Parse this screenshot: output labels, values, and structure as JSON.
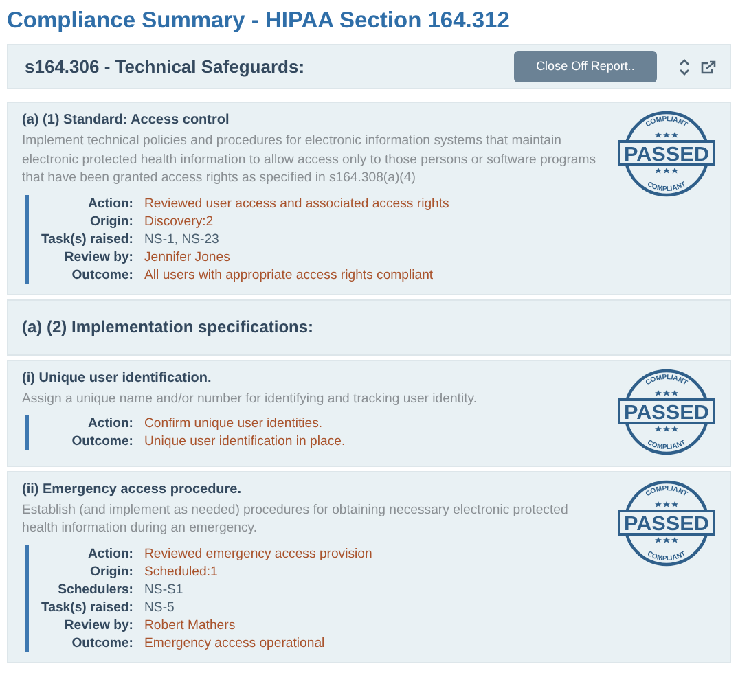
{
  "page_title": "Compliance Summary - HIPAA Section 164.312",
  "header": {
    "title": "s164.306 - Technical Safeguards:",
    "button": "Close Off Report.."
  },
  "sections": [
    {
      "kind": "item",
      "title": "(a) (1) Standard: Access control",
      "description": "Implement technical policies and procedures for electronic information systems that maintain electronic protected health information to allow access only to those persons or software programs that have been granted access rights as specified in s164.308(a)(4)",
      "stamp": {
        "top": "COMPLIANT",
        "label": "PASSED",
        "bottom": "COMPLIANT"
      },
      "details": [
        {
          "label": "Action:",
          "value": "Reviewed user access and associated access rights",
          "kind": "note"
        },
        {
          "label": "Origin:",
          "value": "Discovery:2",
          "kind": "note"
        },
        {
          "label": "Task(s) raised:",
          "value": "NS-1, NS-23",
          "kind": "code"
        },
        {
          "label": "Review by:",
          "value": "Jennifer Jones",
          "kind": "note"
        },
        {
          "label": "Outcome:",
          "value": "All users with appropriate access rights compliant",
          "kind": "note"
        }
      ]
    },
    {
      "kind": "heading",
      "title": "(a) (2) Implementation specifications:"
    },
    {
      "kind": "item",
      "title": "(i) Unique user identification.",
      "description": "Assign a unique name and/or number for identifying and tracking user identity.",
      "stamp": {
        "top": "COMPLIANT",
        "label": "PASSED",
        "bottom": "COMPLIANT"
      },
      "details": [
        {
          "label": "Action:",
          "value": "Confirm unique user identities.",
          "kind": "note"
        },
        {
          "label": "Outcome:",
          "value": "Unique user identification in place.",
          "kind": "note"
        }
      ]
    },
    {
      "kind": "item",
      "title": "(ii) Emergency access procedure.",
      "description": "Establish (and implement as needed) procedures for obtaining necessary electronic protected health information during an emergency.",
      "stamp": {
        "top": "COMPLIANT",
        "label": "PASSED",
        "bottom": "COMPLIANT"
      },
      "details": [
        {
          "label": "Action:",
          "value": "Reviewed emergency access provision",
          "kind": "note"
        },
        {
          "label": "Origin:",
          "value": "Scheduled:1",
          "kind": "note"
        },
        {
          "label": "Schedulers:",
          "value": "NS-S1",
          "kind": "code"
        },
        {
          "label": "Task(s) raised:",
          "value": "NS-5",
          "kind": "code"
        },
        {
          "label": "Review by:",
          "value": "Robert Mathers",
          "kind": "note"
        },
        {
          "label": "Outcome:",
          "value": "Emergency access operational",
          "kind": "note"
        }
      ]
    }
  ]
}
